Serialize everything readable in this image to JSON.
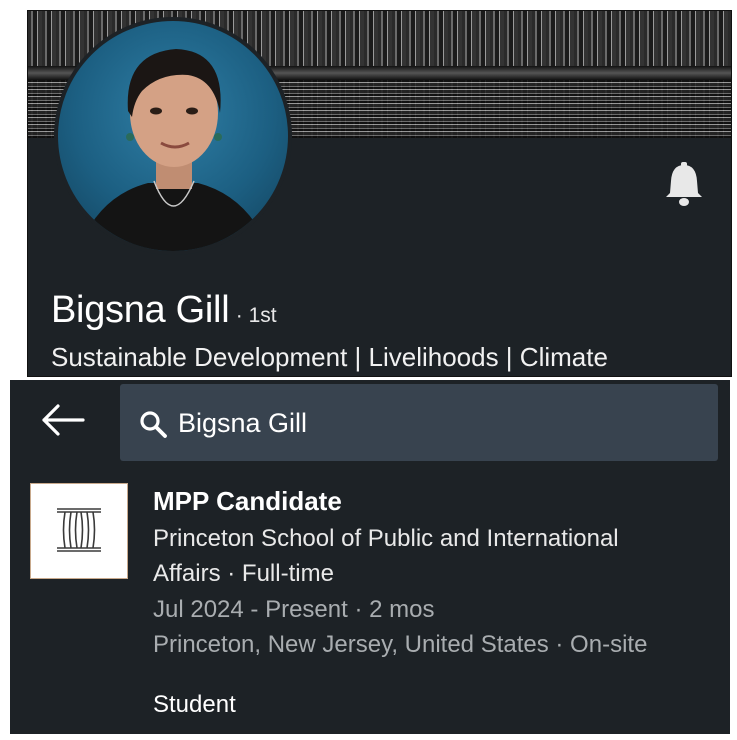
{
  "profile": {
    "name": "Bigsna Gill",
    "degree": "· 1st",
    "headline": "Sustainable Development | Livelihoods | Climate"
  },
  "search": {
    "query": "Bigsna Gill"
  },
  "experience": {
    "title": "MPP Candidate",
    "org_line1": "Princeton School of Public and International",
    "org_line2": "Affairs · Full-time",
    "dates": "Jul 2024 - Present · 2 mos",
    "location": "Princeton, New Jersey, United States · On-site",
    "description": "Student"
  },
  "icons": {
    "notify": "bell-icon",
    "back": "arrow-left-icon",
    "search": "search-icon"
  },
  "colors": {
    "background": "#1d2226",
    "search_field": "#38434f",
    "text_primary": "#ffffff",
    "text_secondary": "#a9adb0"
  }
}
